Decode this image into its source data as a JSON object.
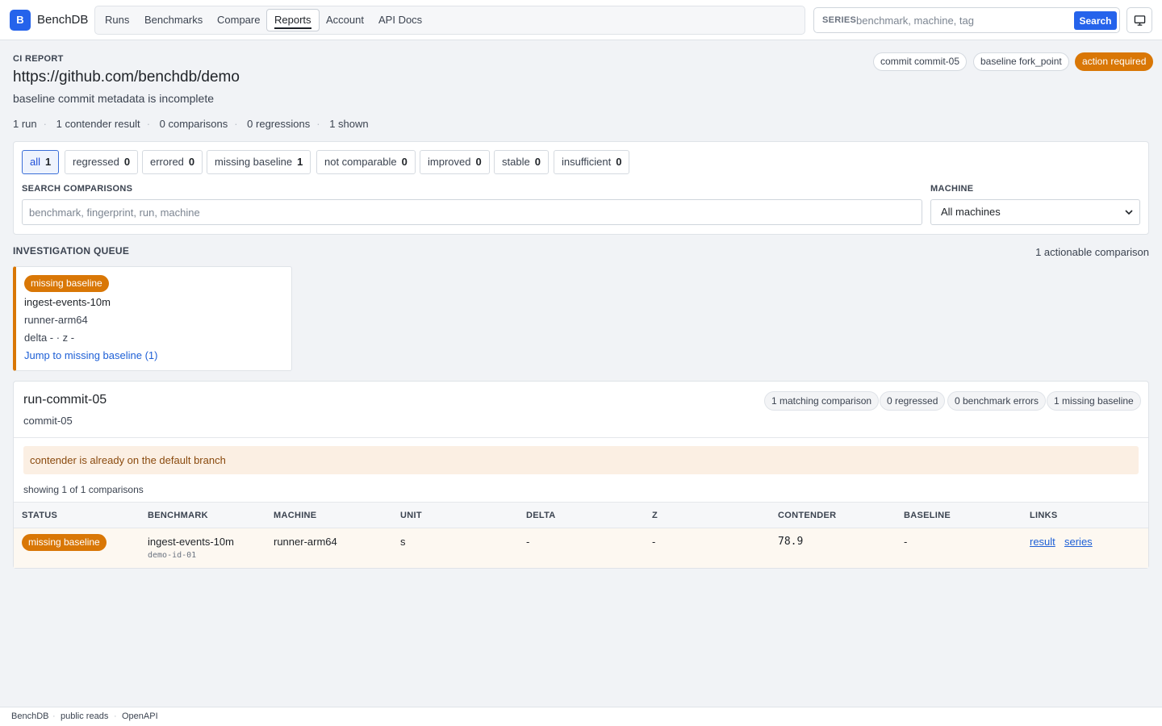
{
  "app": {
    "logo_letter": "B",
    "name": "BenchDB"
  },
  "nav": {
    "items": [
      "Runs",
      "Benchmarks",
      "Compare",
      "Reports",
      "Account",
      "API Docs"
    ],
    "active": "Reports"
  },
  "series_search": {
    "label": "SERIES",
    "placeholder": "benchmark, machine, tag",
    "button": "Search"
  },
  "icons": {
    "display": "monitor-icon"
  },
  "report": {
    "eyebrow": "CI REPORT",
    "title": "https://github.com/benchdb/demo",
    "subtitle": "baseline commit metadata is incomplete",
    "pills": [
      "commit commit-05",
      "baseline fork_point",
      "action required"
    ],
    "stats": [
      "1 run",
      "1 contender result",
      "0 comparisons",
      "0 regressions",
      "1 shown"
    ]
  },
  "filters": {
    "chips": [
      {
        "label": "all",
        "count": "1"
      },
      {
        "label": "regressed",
        "count": "0"
      },
      {
        "label": "errored",
        "count": "0"
      },
      {
        "label": "missing baseline",
        "count": "1"
      },
      {
        "label": "not comparable",
        "count": "0"
      },
      {
        "label": "improved",
        "count": "0"
      },
      {
        "label": "stable",
        "count": "0"
      },
      {
        "label": "insufficient",
        "count": "0"
      }
    ],
    "search_label": "SEARCH COMPARISONS",
    "search_placeholder": "benchmark, fingerprint, run, machine",
    "machine_label": "MACHINE",
    "machine_value": "All machines"
  },
  "queue": {
    "title": "INVESTIGATION QUEUE",
    "count": "1 actionable comparison",
    "card": {
      "badge": "missing baseline",
      "benchmark": "ingest-events-10m",
      "machine": "runner-arm64",
      "delta": "delta - · z -",
      "link": "Jump to missing baseline (1)"
    }
  },
  "run": {
    "title": "run-commit-05",
    "commit": "commit-05",
    "tags": [
      "1 matching comparison",
      "0 regressed",
      "0 benchmark errors",
      "1 missing baseline"
    ],
    "notice": "contender is already on the default branch",
    "showing": "showing 1 of 1 comparisons",
    "columns": [
      "STATUS",
      "BENCHMARK",
      "MACHINE",
      "UNIT",
      "DELTA",
      "Z",
      "CONTENDER",
      "BASELINE",
      "LINKS"
    ],
    "rows": [
      {
        "status": "missing baseline",
        "benchmark": "ingest-events-10m",
        "benchmark_id": "demo-id-01",
        "machine": "runner-arm64",
        "unit": "s",
        "delta": "-",
        "z": "-",
        "contender": "78.9",
        "baseline": "-",
        "links": [
          "result",
          "series"
        ]
      }
    ]
  },
  "footer": {
    "items": [
      "BenchDB",
      "public reads",
      "OpenAPI"
    ]
  },
  "colors": {
    "accent": "#2563eb",
    "warning": "#d97706",
    "notice_bg": "#fbefe3"
  }
}
